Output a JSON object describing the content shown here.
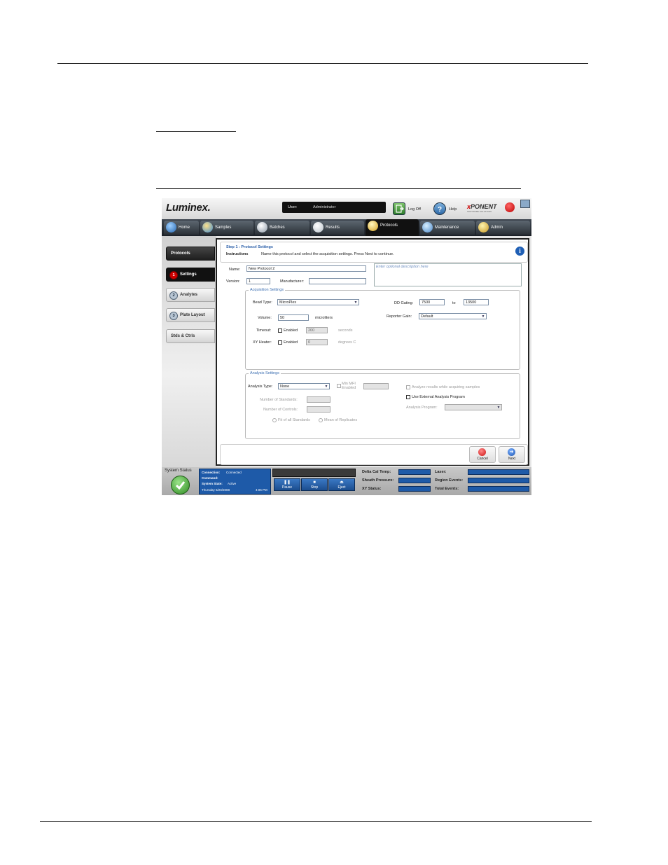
{
  "app": {
    "logo": "Luminex.",
    "user_label": "User:",
    "user_value": "Administrator",
    "logoff_label": "Log Off",
    "help_label": "Help",
    "xponent_prefix": "x",
    "xponent_rest": "PONENT",
    "xponent_sub": "SOFTWARE SOLUTIONS"
  },
  "tabs": [
    {
      "label": "Home",
      "icon": "home-icon"
    },
    {
      "label": "Samples",
      "icon": "samples-icon"
    },
    {
      "label": "Batches",
      "icon": "batches-icon"
    },
    {
      "label": "Results",
      "icon": "results-icon"
    },
    {
      "label": "Protocols",
      "icon": "protocols-icon",
      "active": true
    },
    {
      "label": "Maintenance",
      "icon": "maintenance-icon"
    },
    {
      "label": "Admin",
      "icon": "admin-icon"
    }
  ],
  "nav": {
    "protocols": "Protocols",
    "settings": "Settings",
    "settings_num": "1",
    "analytes": "Analytes",
    "analytes_num": "2",
    "plate_layout": "Plate Layout",
    "plate_layout_num": "3",
    "stds_ctrls": "Stds & Ctrls"
  },
  "step": {
    "title": "Step 1 : Protocol Settings",
    "instructions_label": "Instructions",
    "instructions_text": "Name this protocol and select the acquisition settings.  Press Next to continue."
  },
  "form": {
    "name_label": "Name:",
    "name_value": "New Protocol 2",
    "version_label": "Version:",
    "version_value": "1",
    "manufacturer_label": "Manufacturer:",
    "manufacturer_value": "",
    "description_placeholder": "Enter optional description here"
  },
  "acquisition": {
    "caption": "Acquisition Settings",
    "bead_type_label": "Bead Type:",
    "bead_type_value": "MicroPlex",
    "volume_label": "Volume:",
    "volume_value": "50",
    "volume_unit": "microliters",
    "timeout_label": "Timeout:",
    "timeout_enabled": "Enabled",
    "timeout_value": "200",
    "timeout_unit": "seconds",
    "xy_heater_label": "XY Heater:",
    "xy_heater_enabled": "Enabled",
    "xy_heater_value": "0",
    "xy_heater_unit": "degrees C",
    "dd_gating_label": "DD Gating:",
    "dd_gating_from": "7500",
    "dd_gating_to_label": "to",
    "dd_gating_to": "13500",
    "reporter_gain_label": "Reporter Gain:",
    "reporter_gain_value": "Default"
  },
  "analysis": {
    "caption": "Analysis Settings",
    "type_label": "Analysis Type:",
    "type_value": "None",
    "min_mfi_label": "Min MFI",
    "min_mfi_enabled": "Enabled",
    "num_standards_label": "Number of Standards:",
    "num_controls_label": "Number of Controls:",
    "fit_all_label": "Fit of all Standards",
    "mean_replicates_label": "Mean of Replicates",
    "analyze_while_label": "Analyze results while acquiring samples",
    "use_external_label": "Use External Analysis Program",
    "analysis_program_label": "Analysis Program:"
  },
  "buttons": {
    "cancel": "Cancel",
    "next": "Next"
  },
  "status": {
    "system_status_label": "System Status",
    "connection_label": "Connection:",
    "connection_value": "Connected",
    "command_label": "Command:",
    "system_state_label": "System State:",
    "system_state_value": "Active",
    "date": "Thursday 6/20/2008",
    "time": "4:06 PM",
    "pause": "Pause",
    "stop": "Stop",
    "eject": "Eject",
    "delta_cal_temp": "Delta Cal Temp:",
    "sheath_pressure": "Sheath Pressure:",
    "xy_status": "XY Status:",
    "laser": "Laser:",
    "region_events": "Region Events:",
    "total_events": "Total Events:"
  }
}
